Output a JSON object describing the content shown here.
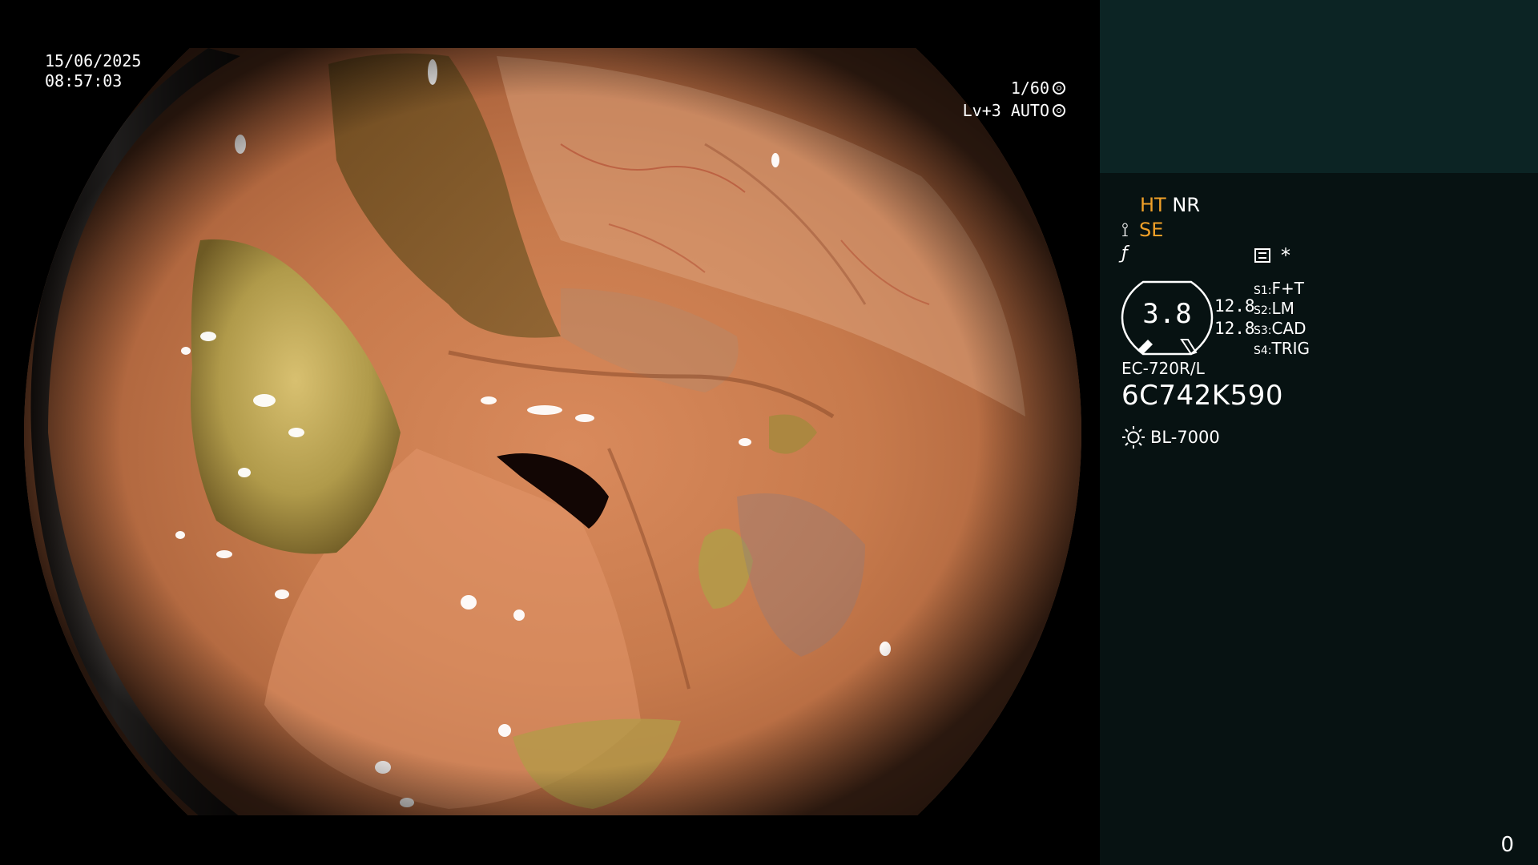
{
  "overlay": {
    "date": "15/06/2025",
    "time": "08:57:03",
    "shutter": "1/60",
    "level": "Lv+3 AUTO"
  },
  "panel": {
    "ht": "HT",
    "nr": "NR",
    "se": "SE",
    "asterisk": "*",
    "gauge_value": "3.8",
    "value_top": "12.8",
    "value_bottom": "12.8",
    "switches": [
      {
        "key": "S1:",
        "label": "F+T"
      },
      {
        "key": "S2:",
        "label": "LM"
      },
      {
        "key": "S3:",
        "label": "CAD"
      },
      {
        "key": "S4:",
        "label": "TRIG"
      }
    ],
    "scope_model": "EC-720R/L",
    "serial": "6C742K590",
    "light_source": "BL-7000",
    "counter": "0"
  },
  "colors": {
    "panel_bg": "#071212",
    "panel_top_bg": "#0c2424",
    "accent": "#f0a028",
    "text": "#ffffff"
  },
  "icons": {
    "shutter": "aperture-icon",
    "auto": "auto-iris-icon",
    "structure": "structure-enhancement-icon",
    "freeze": "freeze-icon",
    "menu": "menu-icon",
    "light": "light-source-icon"
  }
}
